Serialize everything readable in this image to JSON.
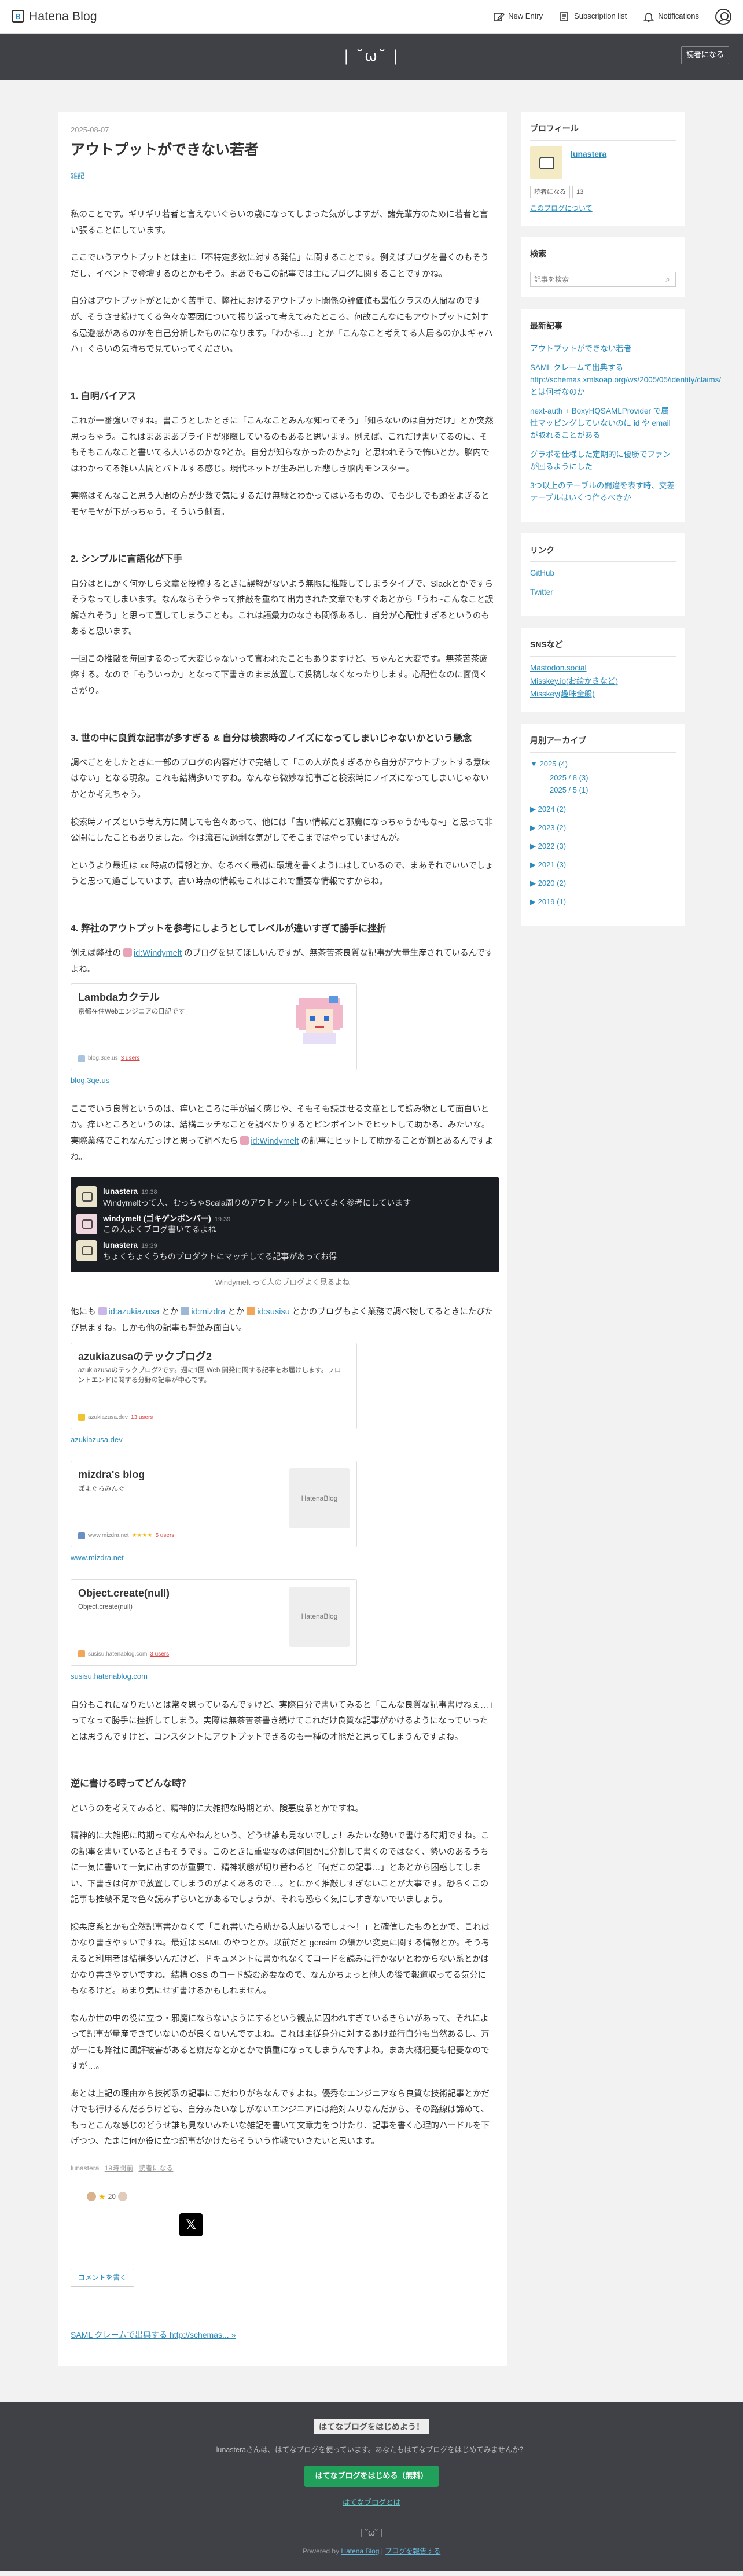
{
  "globalbar": {
    "logo_text": "Hatena Blog",
    "new_entry": "New Entry",
    "subscription": "Subscription list",
    "notifications": "Notifications"
  },
  "header": {
    "blog_title": "| ˘ω˘ |",
    "subscribe": "読者になる"
  },
  "entry": {
    "date": "2025-08-07",
    "title": "アウトプットができない若者",
    "category": "雑記",
    "intro": [
      "私のことです。ギリギリ若者と言えないぐらいの歳になってしまった気がしますが、諸先輩方のために若者と言い張ることにしています。",
      "ここでいうアウトプットとは主に「不特定多数に対する発信」に関することです。例えばブログを書くのもそうだし、イベントで登壇するのとかもそう。まあでもこの記事では主にブログに関することですかね。",
      "自分はアウトプットがとにかく苦手で、弊社におけるアウトプット関係の評価値も最低クラスの人間なのですが、そうさせ続けてくる色々な要因について振り返って考えてみたところ、何故こんなにもアウトプットに対する忌避感があるのかを自己分析したものになります。「わかる…」とか「こんなこと考えてる人居るのかよギャハハ」ぐらいの気持ちで見ていってください。"
    ],
    "s1_heading": "1. 自明バイアス",
    "s1": [
      "これが一番強いですね。書こうとしたときに「こんなことみんな知ってそう」「知らないのは自分だけ」とか突然思っちゃう。これはまあまあプライドが邪魔しているのもあると思います。例えば、これだけ書いてるのに、そもそもこんなこと書いてる人いるのかな?とか。自分が知らなかったのかよ?」と思われそうで怖いとか。脳内ではわかってる雑い人間とバトルする感じ。現代ネットが生み出した悲しき脳内モンスター。",
      "実際はそんなこと思う人間の方が少数で気にするだけ無駄とわかってはいるものの、でも少しでも頭をよぎるとモヤモヤが下がっちゃう。そういう側面。"
    ],
    "s2_heading": "2. シンプルに言語化が下手",
    "s2": [
      "自分はとにかく何かしら文章を投稿するときに誤解がないよう無限に推敲してしまうタイプで、Slackとかですらそうなってしまいます。なんならそうやって推敲を重ねて出力された文章でもすぐあとから「うわ~こんなこと誤解されそう」と思って直してしまうことも。これは語彙力のなさも関係あるし、自分が心配性すぎるというのもあると思います。",
      "一回この推敲を毎回するのって大変じゃないって言われたこともありますけど、ちゃんと大変です。無茶苦茶疲弊する。なので「もういっか」となって下書きのまま放置して投稿しなくなったりします。心配性なのに面倒くさがり。"
    ],
    "s3_heading": "3. 世の中に良質な記事が多すぎる & 自分は検索時のノイズになってしまいじゃないかという懸念",
    "s3": [
      "調べごとをしたときに一部のブログの内容だけで完結して「この人が良すぎるから自分がアウトプットする意味はない」となる現象。これも結構多いですね。なんなら微妙な記事ごと検索時にノイズになってしまいじゃないかとか考えちゃう。",
      "検索時ノイズという考え方に関しても色々あって、他には「古い情報だと邪魔になっちゃうかもな~」と思って非公開にしたこともありました。今は流石に過剰な気がしてそこまではやっていませんが。",
      "というより最近は xx 時点の情報とか、なるべく最初に環境を書くようにはしているので、まあそれでいいでしょうと思って過ごしています。古い時点の情報もこれはこれで重要な情報ですからね。"
    ],
    "s4_heading": "4. 弊社のアウトプットを参考にしようとしてレベルが違いすぎて勝手に挫折",
    "s4_p1_pre": "例えば弊社の",
    "s4_p1_id": "id:Windymelt",
    "s4_p1_post": "のブログを見てほしいんですが、無茶苦茶良質な記事が大量生産されているんですよね。",
    "card1": {
      "title": "Lambdaカクテル",
      "desc": "京都在住Webエンジニアの日記です",
      "site": "blog.3qe.us",
      "users": "3 users"
    },
    "card1_url": "blog.3qe.us",
    "s4_p2_pre": "ここでいう良質というのは、痒いところに手が届く感じや、そもそも読ませる文章として読み物として面白いとか。痒いところというのは、結構ニッチなことを調べたりするとピンポイントでヒットして助かる、みたいな。実際業務でこれなんだっけと思って調べたら",
    "s4_p2_id": "id:Windymelt",
    "s4_p2_post": "の記事にヒットして助かることが割とあるんですよね。",
    "slack": [
      {
        "name": "lunastera",
        "time": "19:38",
        "text": "Windymeltって人、むっちゃScala周りのアウトプットしていてよく参考にしています"
      },
      {
        "name": "windymelt (ゴキゲンボンバー)",
        "time": "19:39",
        "text": "この人よくブログ書いてるよね"
      },
      {
        "name": "lunastera",
        "time": "19:39",
        "text": "ちょくちょくうちのプロダクトにマッチしてる記事があってお得"
      }
    ],
    "slack_caption": "Windymelt って人のブログよく見るよね",
    "s4_p3_a": "他にも",
    "s4_p3_id1": "id:azukiazusa",
    "s4_p3_b": "とか",
    "s4_p3_id2": "id:mizdra",
    "s4_p3_c": "とか",
    "s4_p3_id3": "id:susisu",
    "s4_p3_d": "とかのブログもよく業務で調べ物してるときにたびたび見ますね。しかも他の記事も軒並み面白い。",
    "card2": {
      "title": "azukiazusaのテックブログ2",
      "desc": "azukiazusaのテックブログ2です。週に1回 Web 開発に関する記事をお届けします。フロントエンドに関する分野の記事が中心です。",
      "site": "azukiazusa.dev",
      "users": "13 users"
    },
    "card2_url": "azukiazusa.dev",
    "card3": {
      "title": "mizdra's blog",
      "desc": "ぽよぐらみんぐ",
      "site": "www.mizdra.net",
      "users": "5 users",
      "thumb": "HatenaBlog"
    },
    "card3_url": "www.mizdra.net",
    "card4": {
      "title": "Object.create(null)",
      "desc": "Object.create(null)",
      "site": "susisu.hatenablog.com",
      "users": "3 users",
      "thumb": "HatenaBlog"
    },
    "card4_url": "susisu.hatenablog.com",
    "s4_p4": "自分もこれになりたいとは常々思っているんですけど、実際自分で書いてみると「こんな良質な記事書けねぇ…」ってなって勝手に挫折してしまう。実際は無茶苦茶書き続けてこれだけ良質な記事がかけるようになっていったとは思うんですけど、コンスタントにアウトプットできるのも一種の才能だと思ってしまうんですよね。",
    "s5_heading": "逆に書ける時ってどんな時？",
    "s5": [
      "というのを考えてみると、精神的に大雑把な時期とか、険悪度系とかですね。",
      "精神的に大雑把に時期ってなんやねんという、どうせ誰も見ないでしょ！みたいな勢いで書ける時期ですね。この記事を書いているときもそうです。このときに重要なのは何回かに分割して書くのではなく、勢いのあるうちに一気に書いて一気に出すのが重要で、精神状態が切り替わると「何だこの記事…」とあとから困惑してしまい、下書きは何かで放置してしまうのがよくあるので…。とにかく推敲しすぎないことが大事です。恐らくこの記事も推敲不足で色々読みずらいとかあるでしょうが、それも恐らく気にしすぎないでいましょう。",
      "険悪度系とかも全然記事書かなくて「これ書いたら助かる人居いるでしょ～！」と確信したものとかで、これはかなり書きやすいですね。最近は SAML のやつとか。以前だと gensim の細かい変更に関する情報とか。そう考えると利用者は結構多いんだけど、ドキュメントに書かれなくてコードを読みに行かないとわからない系とかはかなり書きやすいですね。結構 OSS のコード読む必要なので、なんかちょっと他人の後で報道取ってる気分にもなるけど。あまり気にせず書けるかもしれません。",
      "なんか世の中の役に立つ・邪魔にならないようにするという観点に囚われすぎているきらいがあって、それによって記事が量産できていないのが良くないんですよね。これは主従身分に対するあけ並行自分も当然あるし、万が一にも弊社に風評被害があると嫌だなとかとかで慎重になってしまうんですよね。まあ大概杞憂も杞憂なのですが…。",
      "あとは上記の理由から技術系の記事にこだわりがちなんですよね。優秀なエンジニアなら良質な技術記事とかだけでも行けるんだろうけども、自分みたいなしがないエンジニアには絶対ムリなんだから、その路線は諦めて、もっとこんな感じのどうせ誰も見ないみたいな雑記を書いて文章力をつけたり、記事を書く心理的ハードルを下げつつ、たまに何か役に立つ記事がかけたらそういう作戦でいきたいと思います。"
    ],
    "footer_author": "lunastera",
    "footer_time": "19時間前",
    "footer_subscribe": "読者になる",
    "star_count": "20",
    "share_x": "𝕏",
    "comment_btn": "コメントを書く",
    "next_post": "SAML クレームで出典する http://schemas... »"
  },
  "sidebar": {
    "profile_h": "プロフィール",
    "username": "lunastera",
    "reader_btn": "読者になる",
    "reader_count": "13",
    "about_link": "このブログについて",
    "search_h": "検索",
    "search_placeholder": "記事を検索",
    "recent_h": "最新記事",
    "recent": [
      "アウトプットができない若者",
      "SAML クレームで出典する http://schemas.xmlsoap.org/ws/2005/05/identity/claims/ とは何者なのか",
      "next-auth + BoxyHQSAMLProvider で属性マッピングしていないのに id や email が取れることがある",
      "グラポを仕様した定期的に優勝でファンが回るようにした",
      "3つ以上のテーブルの間違を表す時、交差テーブルはいくつ作るべきか"
    ],
    "links_h": "リンク",
    "links": [
      "GitHub",
      "Twitter"
    ],
    "sns_h": "SNSなど",
    "sns": [
      "Mastodon.social",
      "Misskey.io(お絵かきなど)",
      "Misskey(趣味全般)"
    ],
    "archive_h": "月別アーカイブ",
    "archive": {
      "y2025": "▼ 2025 (4)",
      "m2025_8": "2025 / 8 (3)",
      "m2025_5": "2025 / 5 (1)",
      "y2024": "▶ 2024 (2)",
      "y2023": "▶ 2023 (2)",
      "y2022": "▶ 2022 (3)",
      "y2021": "▶ 2021 (3)",
      "y2020": "▶ 2020 (2)",
      "y2019": "▶ 2019 (1)"
    }
  },
  "footer": {
    "promo_title": "はてなブログをはじめよう！",
    "promo_desc": "lunasteraさんは、はてなブログを使っています。あなたもはてなブログをはじめてみませんか？",
    "promo_btn": "はてなブログをはじめる（無料）",
    "promo_learn": "はてなブログとは",
    "logo": "| ˘ω˘ |",
    "powered_pre": "Powered by",
    "powered_link": "Hatena Blog",
    "powered_sep": " | ",
    "report": "ブログを報告する"
  },
  "colors": {
    "header_bg": "#3f4147",
    "link": "#2a8bbb",
    "slack_bg": "#1a1d21",
    "promo_green": "#21a05b"
  }
}
